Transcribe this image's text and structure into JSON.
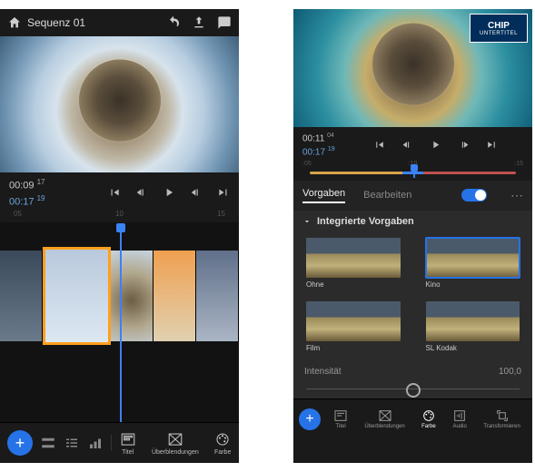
{
  "left": {
    "header": {
      "title": "Sequenz 01"
    },
    "timecode": {
      "current": "00:09",
      "current_frames": "17",
      "total": "00:17",
      "total_frames": "19"
    },
    "ruler": [
      "05",
      "10",
      "15"
    ],
    "tools": [
      {
        "key": "titel",
        "label": "Titel"
      },
      {
        "key": "ueberblendungen",
        "label": "Überblendungen"
      },
      {
        "key": "farbe",
        "label": "Farbe"
      }
    ]
  },
  "right": {
    "badge": {
      "title": "CHIP",
      "subtitle": "UNTERTITEL"
    },
    "timecode": {
      "current": "00:11",
      "current_frames": "04",
      "total": "00:17",
      "total_frames": "19"
    },
    "ruler": [
      ":05",
      ":10",
      ":15"
    ],
    "tabs": {
      "presets": "Vorgaben",
      "edit": "Bearbeiten",
      "active": "presets"
    },
    "section_title": "Integrierte Vorgaben",
    "presets": [
      {
        "key": "ohne",
        "label": "Ohne",
        "selected": false
      },
      {
        "key": "kino",
        "label": "Kino",
        "selected": true
      },
      {
        "key": "film",
        "label": "Film",
        "selected": false
      },
      {
        "key": "slkodak",
        "label": "SL Kodak",
        "selected": false
      }
    ],
    "intensity": {
      "label": "Intensität",
      "value": "100,0"
    },
    "tools": [
      {
        "key": "titel",
        "label": "Titel"
      },
      {
        "key": "ueberblendungen",
        "label": "Überblendungen"
      },
      {
        "key": "farbe",
        "label": "Farbe",
        "active": true
      },
      {
        "key": "audio",
        "label": "Audio"
      },
      {
        "key": "transform",
        "label": "Transformieren"
      }
    ]
  }
}
